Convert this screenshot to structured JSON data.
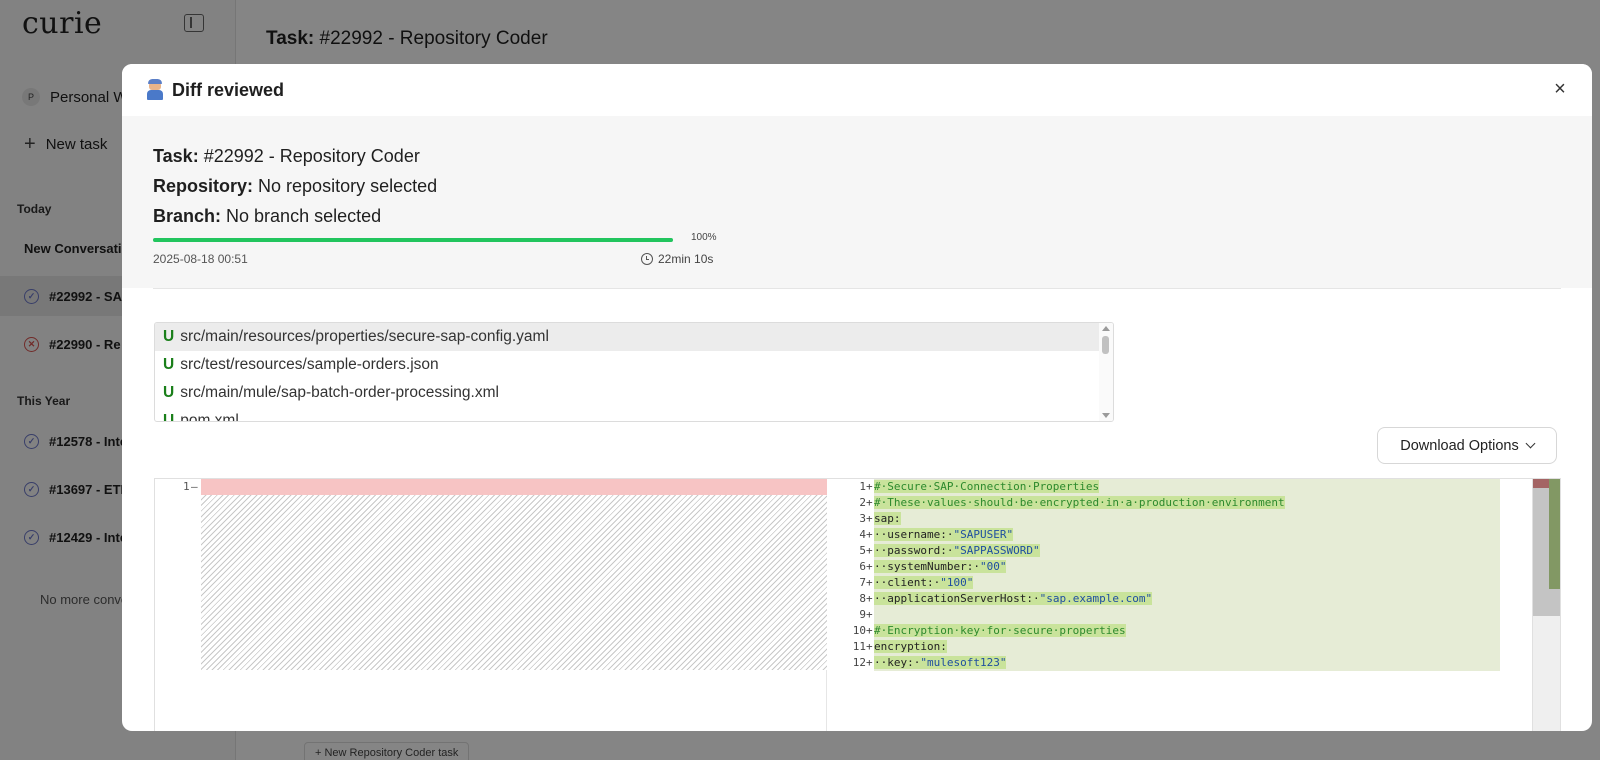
{
  "app": {
    "logo": "curie",
    "workspace": {
      "avatar": "P",
      "name": "Personal W"
    },
    "new_task_label": "New task",
    "sections": [
      {
        "label": "Today"
      },
      {
        "label": "This Year"
      }
    ],
    "today_items": [
      {
        "label": "New Conversatio",
        "status": "none"
      },
      {
        "label": "#22992 - SA",
        "status": "done",
        "active": true
      },
      {
        "label": "#22990 - Re",
        "status": "error"
      }
    ],
    "year_items": [
      {
        "label": "#12578 - Inte",
        "status": "done"
      },
      {
        "label": "#13697 - ETL",
        "status": "done"
      },
      {
        "label": "#12429 - Inte",
        "status": "done"
      }
    ],
    "no_more_text": "No more conve",
    "background": {
      "task_label": "Task:",
      "task_value": "#22992 - Repository Coder",
      "new_repo_task_button": "New Repository Coder task"
    }
  },
  "modal": {
    "title": "Diff reviewed",
    "close_glyph": "×",
    "task_label": "Task:",
    "task_value": "#22992 - Repository Coder",
    "repo_label": "Repository:",
    "repo_value": "No repository selected",
    "branch_label": "Branch:",
    "branch_value": "No branch selected",
    "progress_percent": 100,
    "progress_text": "100%",
    "date": "2025-08-18 00:51",
    "duration": "22min 10s",
    "files": [
      {
        "status": "U",
        "path": "src/main/resources/properties/secure-sap-config.yaml",
        "selected": true
      },
      {
        "status": "U",
        "path": "src/test/resources/sample-orders.json"
      },
      {
        "status": "U",
        "path": "src/main/mule/sap-batch-order-processing.xml"
      },
      {
        "status": "U",
        "path": "pom.xml"
      }
    ],
    "download_label": "Download Options",
    "diff": {
      "left_line": "1",
      "left_marker": "—",
      "right_lines": [
        {
          "n": "1",
          "m": "+",
          "text": "#·Secure·SAP·Connection·Properties",
          "kind": "comment"
        },
        {
          "n": "2",
          "m": "+",
          "text": "#·These·values·should·be·encrypted·in·a·production·environment",
          "kind": "comment"
        },
        {
          "n": "3",
          "m": "+",
          "text": "sap:",
          "kind": "plain"
        },
        {
          "n": "4",
          "m": "+",
          "text": "··username:·\"SAPUSER\"",
          "kind": "kv"
        },
        {
          "n": "5",
          "m": "+",
          "text": "··password:·\"SAPPASSWORD\"",
          "kind": "kv"
        },
        {
          "n": "6",
          "m": "+",
          "text": "··systemNumber:·\"00\"",
          "kind": "kv"
        },
        {
          "n": "7",
          "m": "+",
          "text": "··client:·\"100\"",
          "kind": "kv"
        },
        {
          "n": "8",
          "m": "+",
          "text": "··applicationServerHost:·\"sap.example.com\"",
          "kind": "kv"
        },
        {
          "n": "9",
          "m": "+",
          "text": "",
          "kind": "plain"
        },
        {
          "n": "10",
          "m": "+",
          "text": "#·Encryption·key·for·secure·properties",
          "kind": "comment"
        },
        {
          "n": "11",
          "m": "+",
          "text": "encryption:",
          "kind": "plain"
        },
        {
          "n": "12",
          "m": "+",
          "text": "··key:·\"mulesoft123\"",
          "kind": "kv"
        }
      ]
    }
  },
  "colors": {
    "progress": "#22c55e",
    "added_bg": "#e6ecd6",
    "added_highlight": "#c9e39b",
    "removed_bg": "#f7c4c4",
    "file_status": "#1a7f1a"
  }
}
